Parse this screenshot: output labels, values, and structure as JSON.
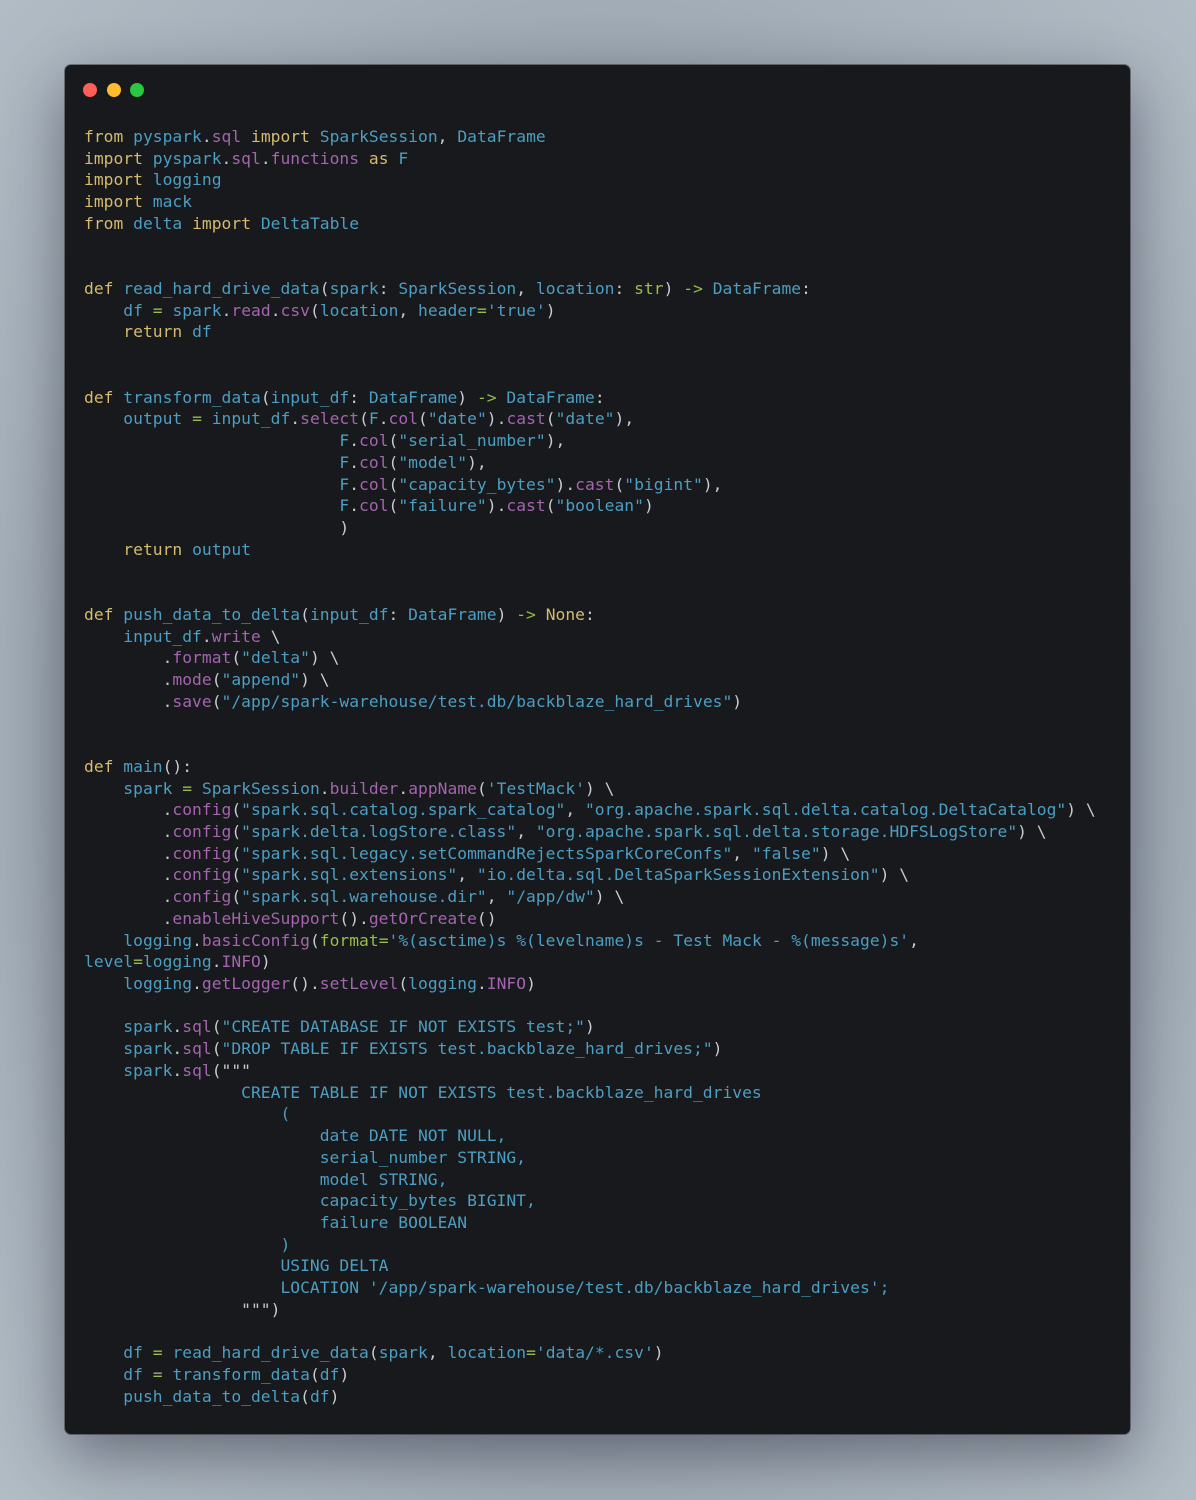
{
  "window": {
    "controls": [
      "close",
      "minimize",
      "maximize"
    ],
    "colors": {
      "background": "#17191c",
      "keyword": "#d5bb6b",
      "identifier": "#4c9ec2",
      "method": "#a464ae",
      "punctuation": "#c7cbd1",
      "operator": "#98bd4a",
      "string": "#4c9ec2"
    }
  },
  "code": {
    "language": "python",
    "lines": [
      [
        [
          "k",
          "from"
        ],
        [
          "p",
          " "
        ],
        [
          "i",
          "pyspark"
        ],
        [
          "p",
          "."
        ],
        [
          "m",
          "sql"
        ],
        [
          "p",
          " "
        ],
        [
          "k",
          "import"
        ],
        [
          "p",
          " "
        ],
        [
          "i",
          "SparkSession"
        ],
        [
          "p",
          ", "
        ],
        [
          "i",
          "DataFrame"
        ]
      ],
      [
        [
          "k",
          "import"
        ],
        [
          "p",
          " "
        ],
        [
          "i",
          "pyspark"
        ],
        [
          "p",
          "."
        ],
        [
          "m",
          "sql"
        ],
        [
          "p",
          "."
        ],
        [
          "m",
          "functions"
        ],
        [
          "p",
          " "
        ],
        [
          "k",
          "as"
        ],
        [
          "p",
          " "
        ],
        [
          "i",
          "F"
        ]
      ],
      [
        [
          "k",
          "import"
        ],
        [
          "p",
          " "
        ],
        [
          "i",
          "logging"
        ]
      ],
      [
        [
          "k",
          "import"
        ],
        [
          "p",
          " "
        ],
        [
          "i",
          "mack"
        ]
      ],
      [
        [
          "k",
          "from"
        ],
        [
          "p",
          " "
        ],
        [
          "i",
          "delta"
        ],
        [
          "p",
          " "
        ],
        [
          "k",
          "import"
        ],
        [
          "p",
          " "
        ],
        [
          "i",
          "DeltaTable"
        ]
      ],
      [],
      [],
      [
        [
          "k",
          "def"
        ],
        [
          "p",
          " "
        ],
        [
          "i",
          "read_hard_drive_data"
        ],
        [
          "p",
          "("
        ],
        [
          "i",
          "spark"
        ],
        [
          "p",
          ": "
        ],
        [
          "i",
          "SparkSession"
        ],
        [
          "p",
          ", "
        ],
        [
          "i",
          "location"
        ],
        [
          "p",
          ": "
        ],
        [
          "o",
          "str"
        ],
        [
          "p",
          ") "
        ],
        [
          "o",
          "->"
        ],
        [
          "p",
          " "
        ],
        [
          "i",
          "DataFrame"
        ],
        [
          "p",
          ":"
        ]
      ],
      [
        [
          "p",
          "    "
        ],
        [
          "i",
          "df"
        ],
        [
          "p",
          " "
        ],
        [
          "o",
          "="
        ],
        [
          "p",
          " "
        ],
        [
          "i",
          "spark"
        ],
        [
          "p",
          "."
        ],
        [
          "m",
          "read"
        ],
        [
          "p",
          "."
        ],
        [
          "m",
          "csv"
        ],
        [
          "p",
          "("
        ],
        [
          "i",
          "location"
        ],
        [
          "p",
          ", "
        ],
        [
          "i",
          "header"
        ],
        [
          "o",
          "="
        ],
        [
          "s",
          "'true'"
        ],
        [
          "p",
          ")"
        ]
      ],
      [
        [
          "p",
          "    "
        ],
        [
          "k",
          "return"
        ],
        [
          "p",
          " "
        ],
        [
          "i",
          "df"
        ]
      ],
      [],
      [],
      [
        [
          "k",
          "def"
        ],
        [
          "p",
          " "
        ],
        [
          "i",
          "transform_data"
        ],
        [
          "p",
          "("
        ],
        [
          "i",
          "input_df"
        ],
        [
          "p",
          ": "
        ],
        [
          "i",
          "DataFrame"
        ],
        [
          "p",
          ") "
        ],
        [
          "o",
          "->"
        ],
        [
          "p",
          " "
        ],
        [
          "i",
          "DataFrame"
        ],
        [
          "p",
          ":"
        ]
      ],
      [
        [
          "p",
          "    "
        ],
        [
          "i",
          "output"
        ],
        [
          "p",
          " "
        ],
        [
          "o",
          "="
        ],
        [
          "p",
          " "
        ],
        [
          "i",
          "input_df"
        ],
        [
          "p",
          "."
        ],
        [
          "m",
          "select"
        ],
        [
          "p",
          "("
        ],
        [
          "i",
          "F"
        ],
        [
          "p",
          "."
        ],
        [
          "m",
          "col"
        ],
        [
          "p",
          "("
        ],
        [
          "s",
          "\"date\""
        ],
        [
          "p",
          ")."
        ],
        [
          "m",
          "cast"
        ],
        [
          "p",
          "("
        ],
        [
          "s",
          "\"date\""
        ],
        [
          "p",
          "),"
        ]
      ],
      [
        [
          "p",
          "                          "
        ],
        [
          "i",
          "F"
        ],
        [
          "p",
          "."
        ],
        [
          "m",
          "col"
        ],
        [
          "p",
          "("
        ],
        [
          "s",
          "\"serial_number\""
        ],
        [
          "p",
          "),"
        ]
      ],
      [
        [
          "p",
          "                          "
        ],
        [
          "i",
          "F"
        ],
        [
          "p",
          "."
        ],
        [
          "m",
          "col"
        ],
        [
          "p",
          "("
        ],
        [
          "s",
          "\"model\""
        ],
        [
          "p",
          "),"
        ]
      ],
      [
        [
          "p",
          "                          "
        ],
        [
          "i",
          "F"
        ],
        [
          "p",
          "."
        ],
        [
          "m",
          "col"
        ],
        [
          "p",
          "("
        ],
        [
          "s",
          "\"capacity_bytes\""
        ],
        [
          "p",
          ")."
        ],
        [
          "m",
          "cast"
        ],
        [
          "p",
          "("
        ],
        [
          "s",
          "\"bigint\""
        ],
        [
          "p",
          "),"
        ]
      ],
      [
        [
          "p",
          "                          "
        ],
        [
          "i",
          "F"
        ],
        [
          "p",
          "."
        ],
        [
          "m",
          "col"
        ],
        [
          "p",
          "("
        ],
        [
          "s",
          "\"failure\""
        ],
        [
          "p",
          ")."
        ],
        [
          "m",
          "cast"
        ],
        [
          "p",
          "("
        ],
        [
          "s",
          "\"boolean\""
        ],
        [
          "p",
          ")"
        ]
      ],
      [
        [
          "p",
          "                          )"
        ]
      ],
      [
        [
          "p",
          "    "
        ],
        [
          "k",
          "return"
        ],
        [
          "p",
          " "
        ],
        [
          "i",
          "output"
        ]
      ],
      [],
      [],
      [
        [
          "k",
          "def"
        ],
        [
          "p",
          " "
        ],
        [
          "i",
          "push_data_to_delta"
        ],
        [
          "p",
          "("
        ],
        [
          "i",
          "input_df"
        ],
        [
          "p",
          ": "
        ],
        [
          "i",
          "DataFrame"
        ],
        [
          "p",
          ") "
        ],
        [
          "o",
          "->"
        ],
        [
          "p",
          " "
        ],
        [
          "k",
          "None"
        ],
        [
          "p",
          ":"
        ]
      ],
      [
        [
          "p",
          "    "
        ],
        [
          "i",
          "input_df"
        ],
        [
          "p",
          "."
        ],
        [
          "m",
          "write"
        ],
        [
          "p",
          " \\"
        ]
      ],
      [
        [
          "p",
          "        ."
        ],
        [
          "m",
          "format"
        ],
        [
          "p",
          "("
        ],
        [
          "s",
          "\"delta\""
        ],
        [
          "p",
          ") \\"
        ]
      ],
      [
        [
          "p",
          "        ."
        ],
        [
          "m",
          "mode"
        ],
        [
          "p",
          "("
        ],
        [
          "s",
          "\"append\""
        ],
        [
          "p",
          ") \\"
        ]
      ],
      [
        [
          "p",
          "        ."
        ],
        [
          "m",
          "save"
        ],
        [
          "p",
          "("
        ],
        [
          "s",
          "\"/app/spark-warehouse/test.db/backblaze_hard_drives\""
        ],
        [
          "p",
          ")"
        ]
      ],
      [],
      [],
      [
        [
          "k",
          "def"
        ],
        [
          "p",
          " "
        ],
        [
          "i",
          "main"
        ],
        [
          "p",
          "():"
        ]
      ],
      [
        [
          "p",
          "    "
        ],
        [
          "i",
          "spark"
        ],
        [
          "p",
          " "
        ],
        [
          "o",
          "="
        ],
        [
          "p",
          " "
        ],
        [
          "i",
          "SparkSession"
        ],
        [
          "p",
          "."
        ],
        [
          "m",
          "builder"
        ],
        [
          "p",
          "."
        ],
        [
          "m",
          "appName"
        ],
        [
          "p",
          "("
        ],
        [
          "s",
          "'TestMack'"
        ],
        [
          "p",
          ") \\"
        ]
      ],
      [
        [
          "p",
          "        ."
        ],
        [
          "m",
          "config"
        ],
        [
          "p",
          "("
        ],
        [
          "s",
          "\"spark.sql.catalog.spark_catalog\""
        ],
        [
          "p",
          ", "
        ],
        [
          "s",
          "\"org.apache.spark.sql.delta.catalog.DeltaCatalog\""
        ],
        [
          "p",
          ") \\"
        ]
      ],
      [
        [
          "p",
          "        ."
        ],
        [
          "m",
          "config"
        ],
        [
          "p",
          "("
        ],
        [
          "s",
          "\"spark.delta.logStore.class\""
        ],
        [
          "p",
          ", "
        ],
        [
          "s",
          "\"org.apache.spark.sql.delta.storage.HDFSLogStore\""
        ],
        [
          "p",
          ") \\"
        ]
      ],
      [
        [
          "p",
          "        ."
        ],
        [
          "m",
          "config"
        ],
        [
          "p",
          "("
        ],
        [
          "s",
          "\"spark.sql.legacy.setCommandRejectsSparkCoreConfs\""
        ],
        [
          "p",
          ", "
        ],
        [
          "s",
          "\"false\""
        ],
        [
          "p",
          ") \\"
        ]
      ],
      [
        [
          "p",
          "        ."
        ],
        [
          "m",
          "config"
        ],
        [
          "p",
          "("
        ],
        [
          "s",
          "\"spark.sql.extensions\""
        ],
        [
          "p",
          ", "
        ],
        [
          "s",
          "\"io.delta.sql.DeltaSparkSessionExtension\""
        ],
        [
          "p",
          ") \\"
        ]
      ],
      [
        [
          "p",
          "        ."
        ],
        [
          "m",
          "config"
        ],
        [
          "p",
          "("
        ],
        [
          "s",
          "\"spark.sql.warehouse.dir\""
        ],
        [
          "p",
          ", "
        ],
        [
          "s",
          "\"/app/dw\""
        ],
        [
          "p",
          ") \\"
        ]
      ],
      [
        [
          "p",
          "        ."
        ],
        [
          "m",
          "enableHiveSupport"
        ],
        [
          "p",
          "()."
        ],
        [
          "m",
          "getOrCreate"
        ],
        [
          "p",
          "()"
        ]
      ],
      [
        [
          "p",
          "    "
        ],
        [
          "i",
          "logging"
        ],
        [
          "p",
          "."
        ],
        [
          "m",
          "basicConfig"
        ],
        [
          "p",
          "("
        ],
        [
          "o",
          "format"
        ],
        [
          "o",
          "="
        ],
        [
          "s",
          "'%(asctime)s %(levelname)s - Test Mack - %(message)s'"
        ],
        [
          "p",
          ","
        ]
      ],
      [
        [
          "i",
          "level"
        ],
        [
          "o",
          "="
        ],
        [
          "i",
          "logging"
        ],
        [
          "p",
          "."
        ],
        [
          "m",
          "INFO"
        ],
        [
          "p",
          ")"
        ]
      ],
      [
        [
          "p",
          "    "
        ],
        [
          "i",
          "logging"
        ],
        [
          "p",
          "."
        ],
        [
          "m",
          "getLogger"
        ],
        [
          "p",
          "()."
        ],
        [
          "m",
          "setLevel"
        ],
        [
          "p",
          "("
        ],
        [
          "i",
          "logging"
        ],
        [
          "p",
          "."
        ],
        [
          "m",
          "INFO"
        ],
        [
          "p",
          ")"
        ]
      ],
      [],
      [
        [
          "p",
          "    "
        ],
        [
          "i",
          "spark"
        ],
        [
          "p",
          "."
        ],
        [
          "m",
          "sql"
        ],
        [
          "p",
          "("
        ],
        [
          "s",
          "\"CREATE DATABASE IF NOT EXISTS test;\""
        ],
        [
          "p",
          ")"
        ]
      ],
      [
        [
          "p",
          "    "
        ],
        [
          "i",
          "spark"
        ],
        [
          "p",
          "."
        ],
        [
          "m",
          "sql"
        ],
        [
          "p",
          "("
        ],
        [
          "s",
          "\"DROP TABLE IF EXISTS test.backblaze_hard_drives;\""
        ],
        [
          "p",
          ")"
        ]
      ],
      [
        [
          "p",
          "    "
        ],
        [
          "i",
          "spark"
        ],
        [
          "p",
          "."
        ],
        [
          "m",
          "sql"
        ],
        [
          "p",
          "(\"\"\""
        ]
      ],
      [
        [
          "s",
          "                CREATE TABLE IF NOT EXISTS test.backblaze_hard_drives"
        ]
      ],
      [
        [
          "s",
          "                    ("
        ]
      ],
      [
        [
          "s",
          "                        date DATE NOT NULL,"
        ]
      ],
      [
        [
          "s",
          "                        serial_number STRING,"
        ]
      ],
      [
        [
          "s",
          "                        model STRING,"
        ]
      ],
      [
        [
          "s",
          "                        capacity_bytes BIGINT,"
        ]
      ],
      [
        [
          "s",
          "                        failure BOOLEAN"
        ]
      ],
      [
        [
          "s",
          "                    )"
        ]
      ],
      [
        [
          "s",
          "                    USING DELTA"
        ]
      ],
      [
        [
          "s",
          "                    LOCATION '/app/spark-warehouse/test.db/backblaze_hard_drives';"
        ]
      ],
      [
        [
          "p",
          "                \"\"\")"
        ]
      ],
      [],
      [
        [
          "p",
          "    "
        ],
        [
          "i",
          "df"
        ],
        [
          "p",
          " "
        ],
        [
          "o",
          "="
        ],
        [
          "p",
          " "
        ],
        [
          "i",
          "read_hard_drive_data"
        ],
        [
          "p",
          "("
        ],
        [
          "i",
          "spark"
        ],
        [
          "p",
          ", "
        ],
        [
          "i",
          "location"
        ],
        [
          "o",
          "="
        ],
        [
          "s",
          "'data/*.csv'"
        ],
        [
          "p",
          ")"
        ]
      ],
      [
        [
          "p",
          "    "
        ],
        [
          "i",
          "df"
        ],
        [
          "p",
          " "
        ],
        [
          "o",
          "="
        ],
        [
          "p",
          " "
        ],
        [
          "i",
          "transform_data"
        ],
        [
          "p",
          "("
        ],
        [
          "i",
          "df"
        ],
        [
          "p",
          ")"
        ]
      ],
      [
        [
          "p",
          "    "
        ],
        [
          "i",
          "push_data_to_delta"
        ],
        [
          "p",
          "("
        ],
        [
          "i",
          "df"
        ],
        [
          "p",
          ")"
        ]
      ]
    ]
  }
}
